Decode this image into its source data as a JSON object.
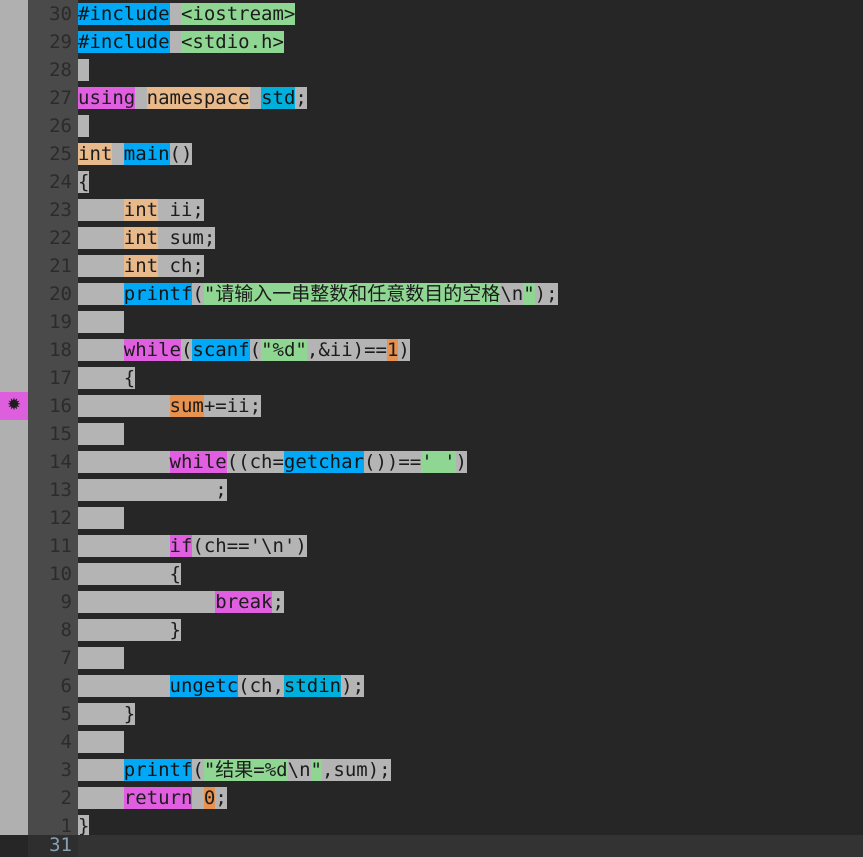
{
  "editor": {
    "title": "code-editor",
    "language": "C++",
    "theme_background": "#262626",
    "gutter_background": "#4a4a4a",
    "marker_strip_background": "#b0b0b0",
    "colors": {
      "plain_token": "#b4b4b4",
      "keyword": "#e05fe0",
      "type": "#e8b98a",
      "function": "#00a8f5",
      "library": "#00b0dc",
      "string": "#8ed692",
      "number": "#e8924f",
      "text": "#1c1c1c",
      "line_number": "#2b2b2b",
      "status_count": "#87a0b4"
    },
    "marker": {
      "line_number": "16",
      "glyph": "✹",
      "icon_name": "bookmark-asterisk-icon",
      "color": "#dd5fdd"
    },
    "status": {
      "total_lines": "31"
    },
    "lines": [
      {
        "num": "30",
        "indent": 0,
        "tokens": [
          {
            "t": "#include",
            "c": "t-fn"
          },
          {
            "t": " ",
            "c": "t-plain"
          },
          {
            "t": "<iostream>",
            "c": "t-str"
          }
        ]
      },
      {
        "num": "29",
        "indent": 0,
        "tokens": [
          {
            "t": "#include",
            "c": "t-fn"
          },
          {
            "t": " ",
            "c": "t-plain"
          },
          {
            "t": "<stdio.h>",
            "c": "t-str"
          }
        ]
      },
      {
        "num": "28",
        "indent": 0,
        "tokens": [
          {
            "t": " ",
            "c": "t-plain"
          }
        ]
      },
      {
        "num": "27",
        "indent": 0,
        "tokens": [
          {
            "t": "using",
            "c": "t-kw"
          },
          {
            "t": " ",
            "c": "t-plain"
          },
          {
            "t": "namespace",
            "c": "t-type"
          },
          {
            "t": " ",
            "c": "t-plain"
          },
          {
            "t": "std",
            "c": "t-lib"
          },
          {
            "t": ";",
            "c": "t-plain"
          }
        ]
      },
      {
        "num": "26",
        "indent": 0,
        "tokens": [
          {
            "t": " ",
            "c": "t-plain"
          }
        ]
      },
      {
        "num": "25",
        "indent": 0,
        "tokens": [
          {
            "t": "int",
            "c": "t-type"
          },
          {
            "t": " ",
            "c": "t-plain"
          },
          {
            "t": "main",
            "c": "t-fn"
          },
          {
            "t": "()",
            "c": "t-plain"
          }
        ]
      },
      {
        "num": "24",
        "indent": 0,
        "tokens": [
          {
            "t": "{",
            "c": "t-plain"
          }
        ]
      },
      {
        "num": "23",
        "indent": 0,
        "tokens": [
          {
            "t": "    ",
            "c": "t-plain"
          },
          {
            "t": "int",
            "c": "t-type"
          },
          {
            "t": " ii;",
            "c": "t-plain"
          }
        ]
      },
      {
        "num": "22",
        "indent": 0,
        "tokens": [
          {
            "t": "    ",
            "c": "t-plain"
          },
          {
            "t": "int",
            "c": "t-type"
          },
          {
            "t": " sum;",
            "c": "t-plain"
          }
        ]
      },
      {
        "num": "21",
        "indent": 0,
        "tokens": [
          {
            "t": "    ",
            "c": "t-plain"
          },
          {
            "t": "int",
            "c": "t-type"
          },
          {
            "t": " ch;",
            "c": "t-plain"
          }
        ]
      },
      {
        "num": "20",
        "indent": 0,
        "tokens": [
          {
            "t": "    ",
            "c": "t-plain"
          },
          {
            "t": "printf",
            "c": "t-fn"
          },
          {
            "t": "(",
            "c": "t-plain"
          },
          {
            "t": "\"请输入一串整数和任意数目的空格",
            "c": "t-str"
          },
          {
            "t": "\\n",
            "c": "t-plain"
          },
          {
            "t": "\"",
            "c": "t-str"
          },
          {
            "t": ");",
            "c": "t-plain"
          }
        ]
      },
      {
        "num": "19",
        "indent": 0,
        "tokens": [
          {
            "t": "    ",
            "c": "t-plain"
          }
        ]
      },
      {
        "num": "18",
        "indent": 0,
        "tokens": [
          {
            "t": "    ",
            "c": "t-plain"
          },
          {
            "t": "while",
            "c": "t-kw"
          },
          {
            "t": "(",
            "c": "t-plain"
          },
          {
            "t": "scanf",
            "c": "t-fn"
          },
          {
            "t": "(",
            "c": "t-plain"
          },
          {
            "t": "\"",
            "c": "t-str"
          },
          {
            "t": "%d",
            "c": "t-str"
          },
          {
            "t": "\"",
            "c": "t-str"
          },
          {
            "t": ",&ii)==",
            "c": "t-plain"
          },
          {
            "t": "1",
            "c": "t-num"
          },
          {
            "t": ")",
            "c": "t-plain"
          }
        ]
      },
      {
        "num": "17",
        "indent": 0,
        "tokens": [
          {
            "t": "    {",
            "c": "t-plain"
          }
        ]
      },
      {
        "num": "16",
        "indent": 0,
        "tokens": [
          {
            "t": "        ",
            "c": "t-plain"
          },
          {
            "t": "sum",
            "c": "t-num"
          },
          {
            "t": "+=ii;",
            "c": "t-plain"
          }
        ]
      },
      {
        "num": "15",
        "indent": 0,
        "tokens": [
          {
            "t": "    ",
            "c": "t-plain"
          }
        ]
      },
      {
        "num": "14",
        "indent": 0,
        "tokens": [
          {
            "t": "        ",
            "c": "t-plain"
          },
          {
            "t": "while",
            "c": "t-kw"
          },
          {
            "t": "((ch=",
            "c": "t-plain"
          },
          {
            "t": "getchar",
            "c": "t-fn"
          },
          {
            "t": "())==",
            "c": "t-plain"
          },
          {
            "t": "' '",
            "c": "t-str"
          },
          {
            "t": ")",
            "c": "t-plain"
          }
        ]
      },
      {
        "num": "13",
        "indent": 0,
        "tokens": [
          {
            "t": "            ;",
            "c": "t-plain"
          }
        ]
      },
      {
        "num": "12",
        "indent": 0,
        "tokens": [
          {
            "t": "    ",
            "c": "t-plain"
          }
        ]
      },
      {
        "num": "11",
        "indent": 0,
        "tokens": [
          {
            "t": "        ",
            "c": "t-plain"
          },
          {
            "t": "if",
            "c": "t-kw"
          },
          {
            "t": "(ch=='\\n')",
            "c": "t-plain"
          }
        ]
      },
      {
        "num": "10",
        "indent": 0,
        "tokens": [
          {
            "t": "        {",
            "c": "t-plain"
          }
        ]
      },
      {
        "num": "9",
        "indent": 0,
        "tokens": [
          {
            "t": "            ",
            "c": "t-plain"
          },
          {
            "t": "break",
            "c": "t-kw"
          },
          {
            "t": ";",
            "c": "t-plain"
          }
        ]
      },
      {
        "num": "8",
        "indent": 0,
        "tokens": [
          {
            "t": "        }",
            "c": "t-plain"
          }
        ]
      },
      {
        "num": "7",
        "indent": 0,
        "tokens": [
          {
            "t": "    ",
            "c": "t-plain"
          }
        ]
      },
      {
        "num": "6",
        "indent": 0,
        "tokens": [
          {
            "t": "        ",
            "c": "t-plain"
          },
          {
            "t": "ungetc",
            "c": "t-fn"
          },
          {
            "t": "(ch,",
            "c": "t-plain"
          },
          {
            "t": "stdin",
            "c": "t-lib"
          },
          {
            "t": ");",
            "c": "t-plain"
          }
        ]
      },
      {
        "num": "5",
        "indent": 0,
        "tokens": [
          {
            "t": "    }",
            "c": "t-plain"
          }
        ]
      },
      {
        "num": "4",
        "indent": 0,
        "tokens": [
          {
            "t": "    ",
            "c": "t-plain"
          }
        ]
      },
      {
        "num": "3",
        "indent": 0,
        "tokens": [
          {
            "t": "    ",
            "c": "t-plain"
          },
          {
            "t": "printf",
            "c": "t-fn"
          },
          {
            "t": "(",
            "c": "t-plain"
          },
          {
            "t": "\"结果=%d",
            "c": "t-str"
          },
          {
            "t": "\\n",
            "c": "t-plain"
          },
          {
            "t": "\"",
            "c": "t-str"
          },
          {
            "t": ",sum);",
            "c": "t-plain"
          }
        ]
      },
      {
        "num": "2",
        "indent": 0,
        "tokens": [
          {
            "t": "    ",
            "c": "t-plain"
          },
          {
            "t": "return",
            "c": "t-kw"
          },
          {
            "t": " ",
            "c": "t-plain"
          },
          {
            "t": "0",
            "c": "t-num"
          },
          {
            "t": ";",
            "c": "t-plain"
          }
        ]
      },
      {
        "num": "1",
        "indent": 0,
        "tokens": [
          {
            "t": "}",
            "c": "t-plain"
          }
        ]
      }
    ]
  }
}
